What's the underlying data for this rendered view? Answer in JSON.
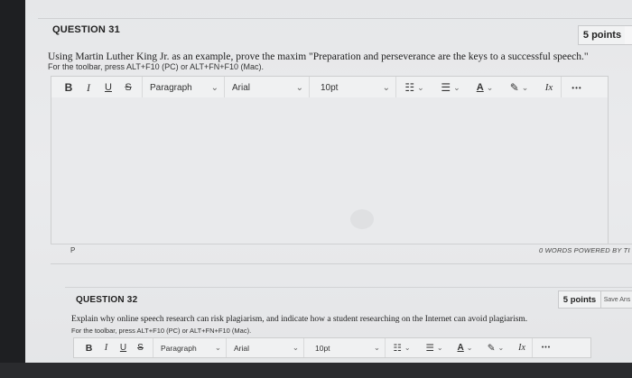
{
  "q31": {
    "title": "QUESTION 31",
    "points": "5 points",
    "text": "Using Martin Luther King Jr. as an example, prove the maxim \"Preparation and perseverance are the keys to a successful speech.\"",
    "hint": "For the toolbar, press ALT+F10 (PC) or ALT+FN+F10 (Mac).",
    "toolbar": {
      "bold": "B",
      "italic": "I",
      "underline": "U",
      "strike": "S",
      "block_format": "Paragraph",
      "font": "Arial",
      "size": "10pt",
      "chevron": "⌄",
      "list_bullet": "☷",
      "list_numbered": "☰",
      "text_color": "A",
      "highlight": "✎",
      "clear_format": "Ix",
      "more": "•••"
    },
    "status_left": "P",
    "status_right": "0 WORDS  POWERED BY TI"
  },
  "q32": {
    "title": "QUESTION 32",
    "points": "5 points",
    "save": "Save Ans",
    "text": "Explain why online speech research can risk plagiarism, and indicate how a student researching on the Internet can avoid plagiarism.",
    "hint": "For the toolbar, press ALT+F10 (PC) or ALT+FN+F10 (Mac).",
    "toolbar": {
      "bold": "B",
      "italic": "I",
      "underline": "U",
      "strike": "S",
      "block_format": "Paragraph",
      "font": "Arial",
      "size": "10pt",
      "chevron": "⌄",
      "list_bullet": "☷",
      "list_numbered": "☰",
      "text_color": "A",
      "highlight": "✎",
      "clear_format": "Ix",
      "more": "•••"
    }
  }
}
